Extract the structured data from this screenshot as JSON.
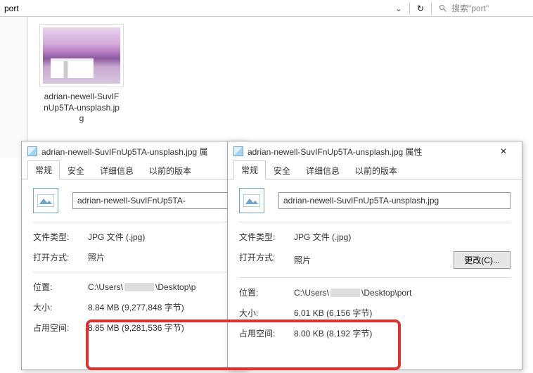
{
  "addressbar": {
    "path": "port",
    "dropdown_glyph": "⌄",
    "refresh_glyph": "↻",
    "search_placeholder": "搜索\"port\""
  },
  "file": {
    "name": "adrian-newell-SuvIFnUp5TA-unsplash.jpg"
  },
  "dialog1": {
    "title": "adrian-newell-SuvIFnUp5TA-unsplash.jpg 属",
    "tabs": [
      "常规",
      "安全",
      "详细信息",
      "以前的版本"
    ],
    "filename": "adrian-newell-SuvIFnUp5TA-",
    "rows": {
      "type_label": "文件类型:",
      "type_value": "JPG 文件 (.jpg)",
      "open_label": "打开方式:",
      "open_value": "照片",
      "loc_label": "位置:",
      "loc_prefix": "C:\\Users\\",
      "loc_suffix": "\\Desktop\\p",
      "size_label": "大小:",
      "size_value": "8.84 MB (9,277,848 字节)",
      "disk_label": "占用空间:",
      "disk_value": "8.85 MB (9,281,536 字节)"
    }
  },
  "dialog2": {
    "title": "adrian-newell-SuvIFnUp5TA-unsplash.jpg 属性",
    "close_glyph": "✕",
    "tabs": [
      "常规",
      "安全",
      "详细信息",
      "以前的版本"
    ],
    "filename": "adrian-newell-SuvIFnUp5TA-unsplash.jpg",
    "rows": {
      "type_label": "文件类型:",
      "type_value": "JPG 文件 (.jpg)",
      "open_label": "打开方式:",
      "open_value": "照片",
      "change_btn": "更改(C)...",
      "loc_label": "位置:",
      "loc_prefix": "C:\\Users\\",
      "loc_suffix": "\\Desktop\\port",
      "size_label": "大小:",
      "size_value": "6.01 KB (6,156 字节)",
      "disk_label": "占用空间:",
      "disk_value": "8.00 KB (8,192 字节)"
    }
  }
}
